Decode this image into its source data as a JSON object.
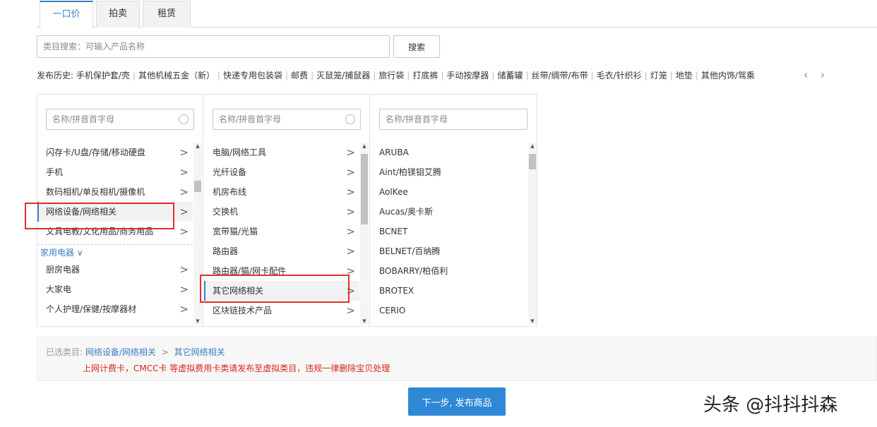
{
  "tabs": [
    {
      "label": "一口价",
      "active": true
    },
    {
      "label": "拍卖",
      "active": false
    },
    {
      "label": "租赁",
      "active": false
    }
  ],
  "search": {
    "placeholder": "类目搜索：可输入产品名称",
    "button_label": "搜索"
  },
  "history": {
    "label": "发布历史:",
    "items": [
      "手机保护套/壳",
      "其他机械五金（新）",
      "快递专用包装袋",
      "邮费",
      "灭鼠笼/捕鼠器",
      "旅行袋",
      "打底裤",
      "手动按摩器",
      "储蓄罐",
      "丝带/绸带/布带",
      "毛衣/针织衫",
      "灯笼",
      "地垫",
      "其他内饰/驾乘"
    ],
    "prev_icon": "‹",
    "next_icon": "›"
  },
  "columns": [
    {
      "filter_placeholder": "名称/拼音首字母",
      "items_a": [
        "闪存卡/U盘/存储/移动硬盘",
        "手机",
        "数码相机/单反相机/摄像机",
        "网络设备/网络相关",
        "文具电教/文化用品/商务用品"
      ],
      "group": "家用电器 ∨",
      "items_b": [
        "厨房电器",
        "大家电",
        "个人护理/保健/按摩器材"
      ]
    },
    {
      "filter_placeholder": "名称/拼音首字母",
      "items": [
        "电脑/网络工具",
        "光纤设备",
        "机房布线",
        "交换机",
        "宽带猫/光猫",
        "路由器",
        "路由器/猫/网卡配件",
        "其它网络相关",
        "区块链技术产品"
      ]
    },
    {
      "filter_placeholder": "名称/拼音首字母",
      "items": [
        "ARUBA",
        "Aint/柏镁钼艾腾",
        "AolKee",
        "Aucas/奥卡斯",
        "BCNET",
        "BELNET/百纳腾",
        "BOBARRY/柏佰利",
        "BROTEX",
        "CERIO"
      ]
    }
  ],
  "selected": {
    "label": "已选类目:",
    "path": [
      "网络设备/网络相关",
      "其它网络相关"
    ],
    "arrow": ">",
    "warning": "上网计费卡，CMCC卡 等虚拟费用卡类请发布至虚拟类目，违规一律删除宝贝处理"
  },
  "next_button": "下一步, 发布商品",
  "watermark": "头条 @抖抖抖森",
  "colors": {
    "accent": "#3c7ec4",
    "button": "#2f88d6",
    "warning": "#d9261c",
    "highlight": "#e0302a"
  }
}
